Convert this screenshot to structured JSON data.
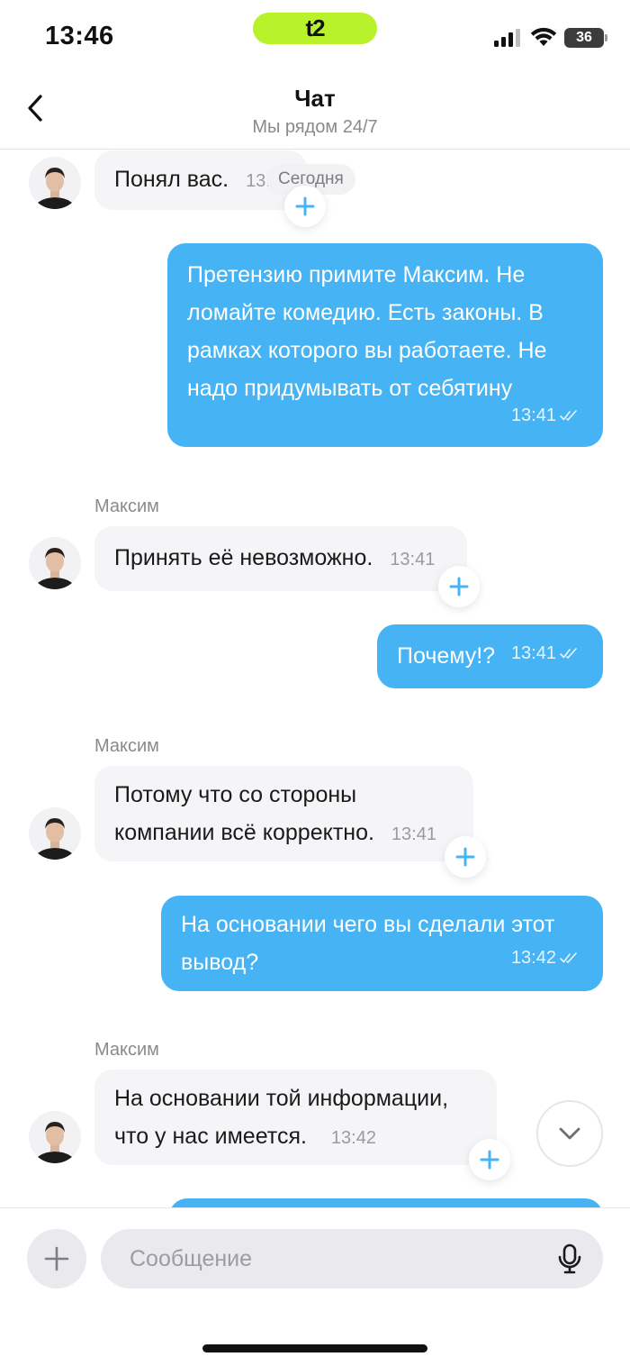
{
  "status_bar": {
    "time": "13:46",
    "carrier_logo": "t2",
    "battery": "36"
  },
  "header": {
    "title": "Чат",
    "subtitle": "Мы рядом 24/7"
  },
  "chat": {
    "date_chip": "Сегодня",
    "messages": [
      {
        "direction": "in",
        "text": "Понял вас.",
        "time": "13:"
      },
      {
        "direction": "out",
        "text": "Претензию примите Максим. Не ломайте комедию. Есть законы. В рамках которого вы работаете. Не надо придумывать от себятину",
        "time": "13:41"
      },
      {
        "direction": "in",
        "sender": "Максим",
        "text": "Принять её невозможно.",
        "time": "13:41"
      },
      {
        "direction": "out",
        "text": "Почему!?",
        "time": "13:41"
      },
      {
        "direction": "in",
        "sender": "Максим",
        "text": "Потому что со стороны компании всё корректно.",
        "time": "13:41"
      },
      {
        "direction": "out",
        "text": "На основании чего вы сделали этот вывод?",
        "time": "13:42"
      },
      {
        "direction": "in",
        "sender": "Максим",
        "text": "На основании той информации, что у нас имеется.",
        "time": "13:42"
      }
    ]
  },
  "composer": {
    "placeholder": "Сообщение"
  },
  "colors": {
    "accent": "#46b3f4",
    "carrier_pill": "#b8f22b",
    "incoming_bubble": "#f5f5f8"
  },
  "icons": {
    "back": "chevron-left-icon",
    "reaction": "plus-icon",
    "scroll_down": "chevron-down-icon",
    "attach": "plus-icon",
    "mic": "microphone-icon",
    "read": "double-check-icon"
  }
}
